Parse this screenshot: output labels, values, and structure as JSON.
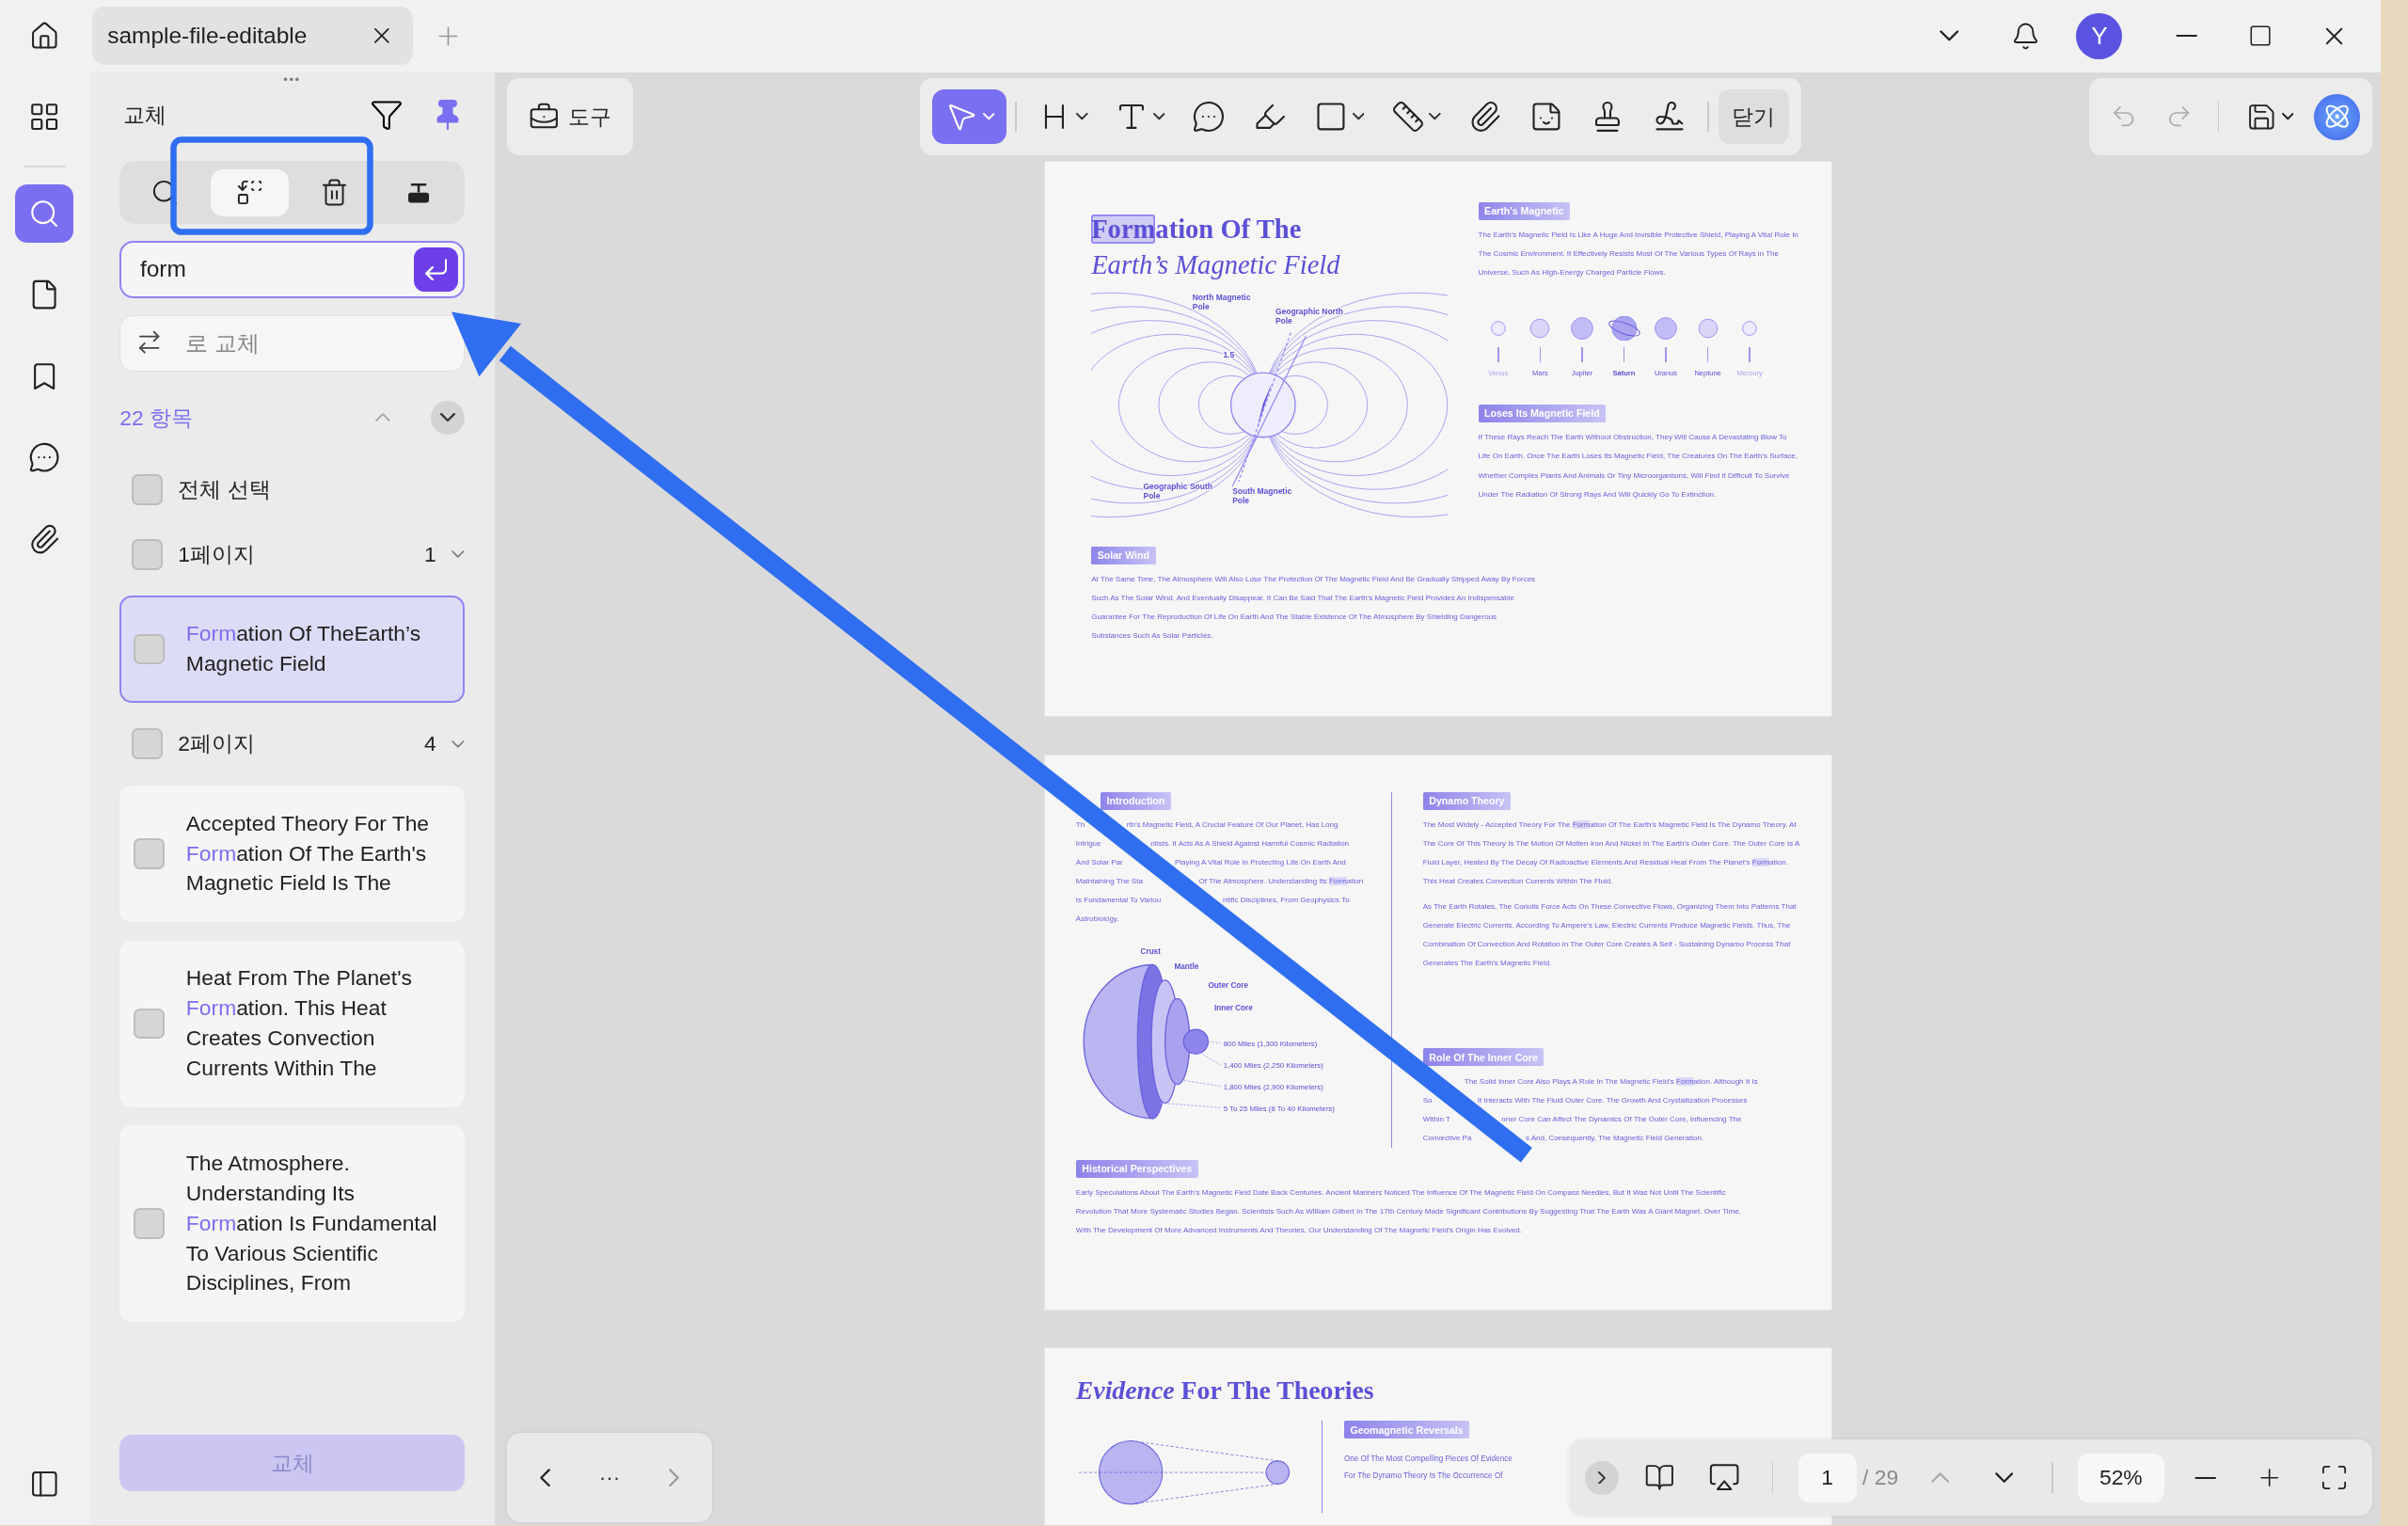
{
  "tabs": [
    {
      "label": "sample-file-editable",
      "selected": true
    }
  ],
  "user": {
    "initial": "Y"
  },
  "rail": [
    {
      "kind": "thumbnails",
      "selected": false
    },
    {
      "kind": "search",
      "selected": true
    },
    {
      "kind": "pages",
      "selected": false
    },
    {
      "kind": "bookmarks",
      "selected": false
    },
    {
      "kind": "comments",
      "selected": false
    },
    {
      "kind": "attachments",
      "selected": false
    }
  ],
  "panel": {
    "handle": "•••",
    "title": "교체",
    "pinned": true,
    "modes": [
      {
        "kind": "search",
        "selected": false
      },
      {
        "kind": "replace",
        "selected": true
      },
      {
        "kind": "delete",
        "selected": false
      },
      {
        "kind": "redact",
        "selected": false
      }
    ],
    "search_value": "form",
    "replace_placeholder": "로 교체",
    "count": "22 항목",
    "select_all": {
      "label": "전체 선택",
      "checked": false
    },
    "groups": [
      {
        "label": "1페이지",
        "count": "1",
        "checked": false,
        "results": [
          {
            "match": "Form",
            "after": "ation Of TheEarth’s Magnetic Field",
            "checked": false,
            "selected": true
          }
        ]
      },
      {
        "label": "2페이지",
        "count": "4",
        "checked": false,
        "results": [
          {
            "before": "Accepted Theory For The ",
            "match": "Form",
            "after": "ation Of The Earth's Magnetic Field Is The",
            "checked": false,
            "selected": false
          },
          {
            "before": "Heat From The Planet's ",
            "match": "Form",
            "after": "ation. This Heat Creates Convection Currents Within The",
            "checked": false,
            "selected": false
          },
          {
            "before": "The Atmosphere. Understanding Its ",
            "match": "Form",
            "after": "ation Is Fundamental To Various Scientific Disciplines, From",
            "checked": false,
            "selected": false
          }
        ]
      }
    ],
    "replace_button": {
      "label": "교체",
      "disabled": true
    }
  },
  "toolbar": {
    "tools_label": "도구",
    "close_label": "닫기",
    "tools": [
      {
        "kind": "select",
        "selected": true,
        "menu": true
      },
      {
        "kind": "heading",
        "selected": false,
        "menu": true
      },
      {
        "kind": "text",
        "selected": false,
        "menu": true
      },
      {
        "kind": "comment",
        "selected": false,
        "menu": false
      },
      {
        "kind": "highlight",
        "selected": false,
        "menu": false
      },
      {
        "kind": "shape",
        "selected": false,
        "menu": true
      },
      {
        "kind": "measure",
        "selected": false,
        "menu": true
      },
      {
        "kind": "attach",
        "selected": false,
        "menu": false
      },
      {
        "kind": "sticker",
        "selected": false,
        "menu": false
      },
      {
        "kind": "stamp",
        "selected": false,
        "menu": false
      },
      {
        "kind": "signature",
        "selected": false,
        "menu": false
      }
    ]
  },
  "page1": {
    "title": [
      {
        "text": "Form",
        "highlight": true
      },
      {
        "text": "ation Of The",
        "highlight": false
      }
    ],
    "subtitle": "Earth’s Magnetic Field",
    "diagram_labels": [
      "North Magnetic Pole",
      "Geographic North Pole",
      "1.5",
      "Geographic South Pole",
      "South Magnetic Pole"
    ],
    "planets": [
      {
        "name": "Venus"
      },
      {
        "name": "Mars"
      },
      {
        "name": "Jupiter"
      },
      {
        "name": "Saturn"
      },
      {
        "name": "Uranus"
      },
      {
        "name": "Neptune"
      },
      {
        "name": "Mercury"
      }
    ],
    "sections": [
      {
        "heading": "Earth's Magnetic",
        "paragraphs": [
          [
            {
              "text": "The Earth's Magnetic Field Is Like A Huge And Invisible Protective Shield, Playing A Vital Role In The Cosmic Environment. It Effectively Resists Most Of The Various Types Of Rays in The Universe, Such As High-Energy Charged Particle Flows.",
              "highlight": false
            }
          ]
        ]
      },
      {
        "heading": "Loses Its Magnetic Field",
        "paragraphs": [
          [
            {
              "text": "If These Rays Reach The Earth Without Obstruction, They Will Cause A Devastating Blow To Life On Earth. Once The Earth Loses Its Magnetic Field, The Creatures On The Earth's Surface, Whether Complex Plants And Animals Or Tiny Microorganisms, Will Find It Difficult To Survive Under The Radiation Of Strong Rays And Will Quickly Go To Extinction.",
              "highlight": false
            }
          ]
        ]
      },
      {
        "heading": "Solar Wind",
        "paragraphs": [
          [
            {
              "text": "At The Same Time, The Atmosphere Will Also Lose The Protection Of The Magnetic Field And Be Gradually Stripped Away By Forces Such As The Solar Wind, And Eventually Disappear. It Can Be Said That The Earth's Magnetic Field Provides An Indispensable Guarantee For The Reproduction Of Life On Earth And The Stable Existence Of The Atmosphere By Shielding Dangerous Substances Such As Solar Particles.",
              "highlight": false
            }
          ]
        ]
      }
    ]
  },
  "page2": {
    "diagram_labels": [
      "Crust",
      "Mantle",
      "Outer Core",
      "Inner Core",
      "800 Miles (1,300 Kilometers)",
      "1,400 Miles (2,250 Kilometers)",
      "1,800 Miles (2,900 Kilometers)",
      "5 To 25 Miles (8 To 40 Kilometers)"
    ],
    "introduction": {
      "heading": "Introduction",
      "lines": [
        {
          "left": [
            {
              "text": "Th",
              "highlight": false
            }
          ],
          "right": [
            {
              "text": "rth's Magnetic Field, A Crucial Feature Of Our Planet, Has Long",
              "highlight": false
            }
          ]
        },
        {
          "left": [
            {
              "text": "Intrigue",
              "highlight": false
            }
          ],
          "right": [
            {
              "text": "ntists. It Acts As A Shield Against Harmful Cosmic Radiation",
              "highlight": false
            }
          ]
        },
        {
          "left": [
            {
              "text": "And Solar Par",
              "highlight": false
            }
          ],
          "right": [
            {
              "text": "Playing A Vital Role In Protecting Life On Earth And",
              "highlight": false
            }
          ]
        },
        {
          "left": [
            {
              "text": "Maintaining The Sta",
              "highlight": false
            }
          ],
          "right": [
            {
              "text": "Of The Atmosphere. Understanding Its ",
              "highlight": false
            },
            {
              "text": "Form",
              "highlight": true
            },
            {
              "text": "ation",
              "highlight": false
            }
          ]
        },
        {
          "left": [
            {
              "text": "Is Fundamental To Variou",
              "highlight": false
            }
          ],
          "right": [
            {
              "text": "ntific Disciplines, From Geophysics To",
              "highlight": false
            }
          ]
        },
        {
          "left": [
            {
              "text": "Astrobiology.",
              "highlight": false
            }
          ]
        }
      ]
    },
    "dynamo": {
      "heading": "Dynamo Theory",
      "paragraphs": [
        [
          {
            "text": "The Most Widely - Accepted Theory For The ",
            "highlight": false
          },
          {
            "text": "Form",
            "highlight": true
          },
          {
            "text": "ation Of The Earth's Magnetic Field Is The Dynamo Theory. At The Core Of This Theory Is The Motion Of Molten Iron And Nickel In The Earth's Outer Core. The Outer Core Is A Fluid Layer, Heated By The Decay Of Radioactive Elements And Residual Heat From The Planet's ",
            "highlight": false
          },
          {
            "text": "Form",
            "highlight": true
          },
          {
            "text": "ation. This Heat Creates Convection Currents Within The Fluid.",
            "highlight": false
          }
        ],
        [
          {
            "text": "As The Earth Rotates, The Coriolis Force Acts On These Convective Flows, Organizing Them Into Patterns That Generate Electric Currents. According To Ampere's Law, Electric Currents Produce Magnetic Fields. Thus, The Combination Of Convection And Rotation in The Outer Core Creates A Self - Sustaining Dynamo Process That Generates The Earth's Magnetic Field.",
            "highlight": false
          }
        ]
      ]
    },
    "inner_core": {
      "heading": "Role Of The Inner Core",
      "lines": [
        {
          "right": [
            {
              "text": "The Solid Inner Core Also Plays A Role In The Magnetic Field's ",
              "highlight": false
            },
            {
              "text": "Form",
              "highlight": true
            },
            {
              "text": "ation. Although It Is",
              "highlight": false
            }
          ]
        },
        {
          "left": [
            {
              "text": "So",
              "highlight": false
            }
          ],
          "right": [
            {
              "text": "It Interacts With The Fluid Outer Core. The Growth And Crystallization Processes",
              "highlight": false
            }
          ]
        },
        {
          "left": [
            {
              "text": "Within T",
              "highlight": false
            }
          ],
          "right": [
            {
              "text": "nner Core Can Affect The Dynamics Of The Outer Core, Influencing The",
              "highlight": false
            }
          ]
        },
        {
          "left": [
            {
              "text": "Convective Pa",
              "highlight": false
            }
          ],
          "right": [
            {
              "text": "s And, Consequently, The Magnetic Field Generation.",
              "highlight": false
            }
          ]
        }
      ]
    },
    "history": {
      "heading": "Historical Perspectives",
      "paragraphs": [
        [
          {
            "text": "Early Speculations About The Earth's Magnetic Field Date Back Centuries. Ancient Mariners Noticed The Influence Of The Magnetic Field On Compass Needles, But It Was Not Until The Scientific Revolution That More Systematic Studies Began. Scientists Such As William Gilbert In The 17th Century Made Significant Contributions By Suggesting That The Earth Was A Giant Magnet. Over Time, With The Development Of More Advanced Instruments And Theories, Our Understanding Of The Magnetic Field's Origin Has Evolved.",
            "highlight": false
          }
        ]
      ]
    }
  },
  "page3": {
    "title": "*Evidence* For The Theories",
    "heading": "Geomagnetic Reversals",
    "lines": [
      "One Of The Most Compelling Pieces Of Evidence",
      "For The Dynamo Theory Is The Occurrence Of"
    ]
  },
  "pager": {
    "page": "1",
    "total": "/ 29",
    "zoom": "52%",
    "more": "···"
  }
}
